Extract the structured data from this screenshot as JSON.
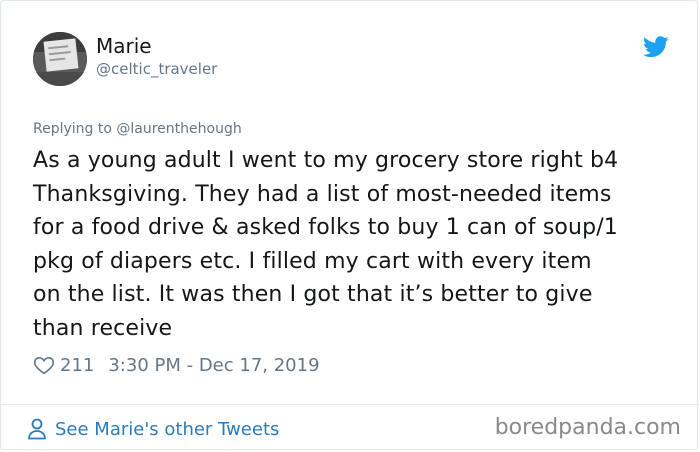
{
  "author": {
    "name": "Marie",
    "handle": "@celtic_traveler"
  },
  "reply": {
    "prefix": "Replying to",
    "handle": "@laurenthehough"
  },
  "tweet": {
    "lines": [
      "As a young adult I went to my grocery store right b4",
      "Thanksgiving. They had a list of most-needed items",
      "for a food drive & asked folks to buy 1 can of soup/1",
      "pkg of diapers etc. I filled my cart with every item",
      "on the list. It was then I got that it’s better to give",
      "than receive"
    ]
  },
  "meta": {
    "likes": "211",
    "timestamp": "3:30 PM - Dec 17, 2019"
  },
  "footer": {
    "see_more_label": "See Marie's other Tweets",
    "watermark": "boredpanda.com"
  },
  "icons": {
    "twitter_bird": "twitter-bird-icon",
    "heart": "heart-icon",
    "person": "person-icon"
  },
  "colors": {
    "twitter_blue": "#1da1f2",
    "link_blue": "#2b7bb9",
    "muted_gray": "#657786",
    "text": "#14171a",
    "border": "#e1e8ed"
  }
}
